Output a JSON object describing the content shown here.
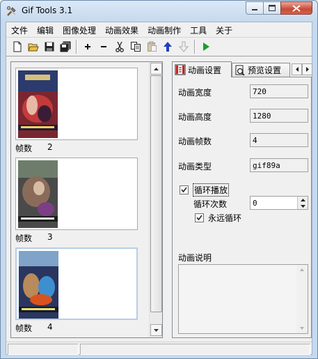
{
  "window": {
    "title": "Gif Tools 3.1"
  },
  "menu": [
    "文件",
    "编辑",
    "图像处理",
    "动画效果",
    "动画制作",
    "工具",
    "关于"
  ],
  "toolbar": {
    "buttons": [
      "new-icon",
      "open-icon",
      "save-icon",
      "save-all-icon",
      "add-icon",
      "remove-icon",
      "cut-icon",
      "copy-icon",
      "paste-icon",
      "move-up-icon",
      "move-down-icon",
      "play-icon"
    ]
  },
  "frames": [
    {
      "label": "帧数",
      "number": "2"
    },
    {
      "label": "帧数",
      "number": "3"
    },
    {
      "label": "帧数",
      "number": "4"
    }
  ],
  "tabs": [
    {
      "label": "动画设置"
    },
    {
      "label": "预览设置"
    }
  ],
  "settings": {
    "width_label": "动画宽度",
    "width_value": "720",
    "height_label": "动画高度",
    "height_value": "1280",
    "frames_label": "动画帧数",
    "frames_value": "4",
    "type_label": "动画类型",
    "type_value": "gif89a",
    "loop_label": "循环播放",
    "loop_count_label": "循环次数",
    "loop_count_value": "0",
    "forever_label": "永远循环",
    "desc_label": "动画说明"
  }
}
